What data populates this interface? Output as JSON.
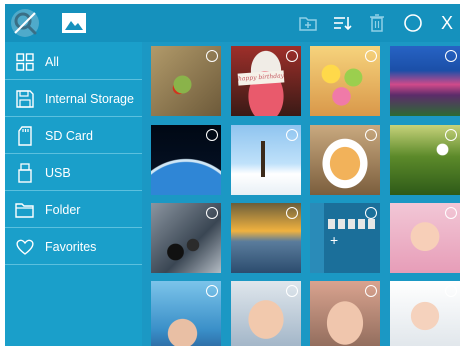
{
  "colors": {
    "topbar": "#1591bd",
    "sidebar": "#1a9fca",
    "grid_background": "#1b98c4",
    "divider": "#5cc0de",
    "text": "#ffffff"
  },
  "toolbar": {
    "icons": [
      "app-logo-icon",
      "pictures-icon",
      "new-folder-icon",
      "sort-icon",
      "delete-icon",
      "select-all-circle-icon",
      "close-icon"
    ],
    "close_label": "X"
  },
  "sidebar": {
    "items": [
      {
        "label": "All",
        "icon": "grid-icon"
      },
      {
        "label": "Internal Storage",
        "icon": "floppy-disk-icon"
      },
      {
        "label": "SD Card",
        "icon": "sd-card-icon"
      },
      {
        "label": "USB",
        "icon": "usb-icon"
      },
      {
        "label": "Folder",
        "icon": "folder-icon"
      },
      {
        "label": "Favorites",
        "icon": "heart-icon"
      }
    ]
  },
  "gallery": {
    "thumbnails": [
      {
        "subject": "frog-on-leaf"
      },
      {
        "subject": "birthday-cake",
        "caption": "happy birthday"
      },
      {
        "subject": "easter-eggs"
      },
      {
        "subject": "mountain-lake"
      },
      {
        "subject": "earth-from-space"
      },
      {
        "subject": "snowy-tree"
      },
      {
        "subject": "pasta-plate"
      },
      {
        "subject": "golf-ball"
      },
      {
        "subject": "mountain-biker"
      },
      {
        "subject": "sunset-lake"
      },
      {
        "subject": "app-screenshot"
      },
      {
        "subject": "baby-pink-hood"
      },
      {
        "subject": "baby-blue"
      },
      {
        "subject": "baby-grey"
      },
      {
        "subject": "baby-closeup"
      },
      {
        "subject": "baby-white-towel"
      }
    ]
  }
}
